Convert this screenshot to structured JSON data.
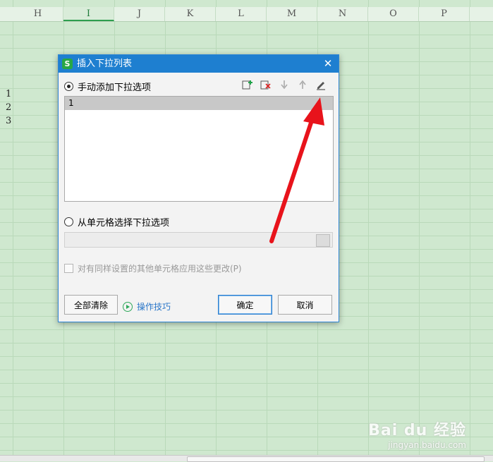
{
  "columns": [
    "H",
    "I",
    "J",
    "K",
    "L",
    "M",
    "N",
    "O",
    "P"
  ],
  "active_column": "I",
  "rows": [
    "1",
    "2",
    "3"
  ],
  "dialog": {
    "title": "插入下拉列表",
    "app_icon": "S",
    "close_glyph": "✕",
    "manual_option": "手动添加下拉选项",
    "manual_selected": true,
    "list_items": [
      "1"
    ],
    "cell_option": "从单元格选择下拉选项",
    "apply_checkbox": "对有同样设置的其他单元格应用这些更改(P)",
    "clear_all": "全部清除",
    "tips": "操作技巧",
    "ok": "确定",
    "cancel": "取消",
    "toolbar_icons": [
      "add-item-icon",
      "delete-item-icon",
      "move-down-icon",
      "move-up-icon",
      "edit-pencil-icon"
    ]
  },
  "watermark": {
    "logo": "Bai du 经验",
    "url": "jingyan.baidu.com"
  },
  "colors": {
    "sheet_bg": "#cfe8cf",
    "title_bar": "#1e7fd0",
    "arrow": "#e8131b",
    "active_col": "#2e9e4f"
  }
}
